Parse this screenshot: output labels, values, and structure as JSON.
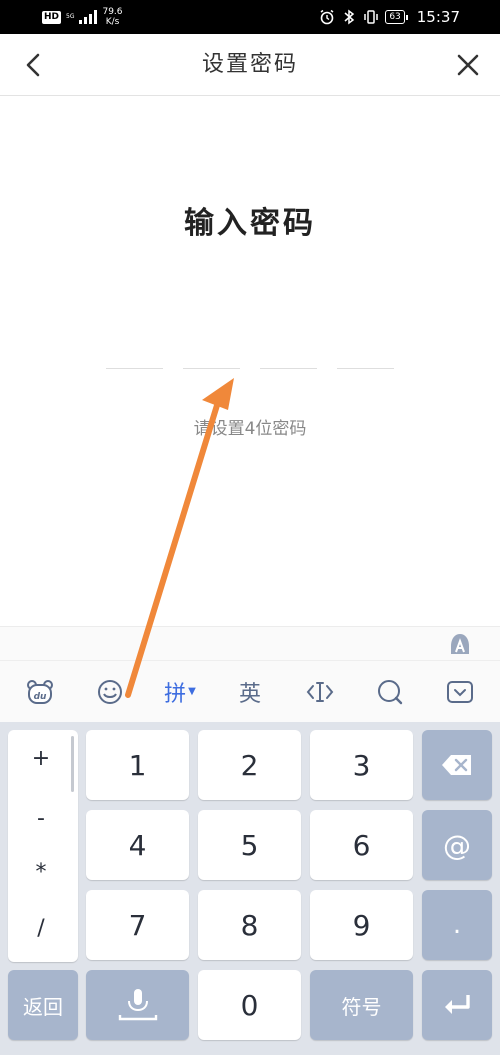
{
  "status_bar": {
    "hd": "HD",
    "network": "5G",
    "speed_value": "79.6",
    "speed_unit": "K/s",
    "battery": "63",
    "time": "15:37"
  },
  "header": {
    "title": "设置密码"
  },
  "main": {
    "heading": "输入密码",
    "hint": "请设置4位密码",
    "pin_length": 4
  },
  "keyboard": {
    "toolbar": {
      "pinyin": "拼",
      "english": "英"
    },
    "symbols": [
      "+",
      "-",
      "*",
      "/"
    ],
    "digits": [
      "1",
      "2",
      "3",
      "4",
      "5",
      "6",
      "7",
      "8",
      "9",
      "0"
    ],
    "at": "@",
    "dot": ".",
    "return_label": "返回",
    "symbol_label": "符号"
  },
  "colors": {
    "accent": "#3d6de0",
    "key_dark": "#a7b5cc",
    "arrow": "#f0883a"
  }
}
